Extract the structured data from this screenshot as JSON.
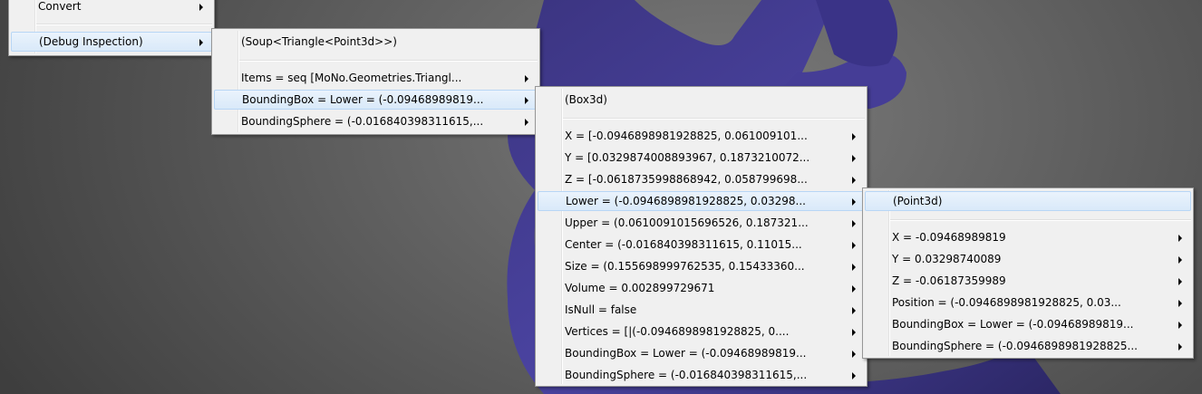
{
  "menu1": {
    "items": [
      {
        "label": "Convert",
        "has_submenu": true
      },
      {
        "label": "(Debug Inspection)",
        "has_submenu": true,
        "highlighted": true
      }
    ]
  },
  "menu2": {
    "header": "(Soup<Triangle<Point3d>>)",
    "items": [
      {
        "label": "Items = seq  [MoNo.Geometries.Triangl...",
        "has_submenu": true
      },
      {
        "label": "BoundingBox = Lower = (-0.09468989819...",
        "has_submenu": true,
        "highlighted": true
      },
      {
        "label": "BoundingSphere = (-0.016840398311615,...",
        "has_submenu": true
      }
    ]
  },
  "menu3": {
    "header": "(Box3d)",
    "items": [
      {
        "label": "X = [-0.0946898981928825, 0.061009101...",
        "has_submenu": true
      },
      {
        "label": "Y = [0.0329874008893967, 0.1873210072...",
        "has_submenu": true
      },
      {
        "label": "Z = [-0.0618735998868942, 0.058799698...",
        "has_submenu": true
      },
      {
        "label": "Lower = (-0.0946898981928825, 0.03298...",
        "has_submenu": true,
        "highlighted": true
      },
      {
        "label": "Upper = (0.0610091015696526, 0.187321...",
        "has_submenu": true
      },
      {
        "label": "Center = (-0.016840398311615, 0.11015...",
        "has_submenu": true
      },
      {
        "label": "Size = (0.155698999762535, 0.15433360...",
        "has_submenu": true
      },
      {
        "label": "Volume = 0.002899729671",
        "has_submenu": true
      },
      {
        "label": "IsNull = false",
        "has_submenu": true
      },
      {
        "label": "Vertices = [|(-0.0946898981928825, 0....",
        "has_submenu": true
      },
      {
        "label": "BoundingBox = Lower = (-0.09468989819...",
        "has_submenu": true
      },
      {
        "label": "BoundingSphere = (-0.016840398311615,...",
        "has_submenu": true
      }
    ]
  },
  "menu4": {
    "header": "(Point3d)",
    "items": [
      {
        "label": "X = -0.09468989819",
        "has_submenu": true
      },
      {
        "label": "Y = 0.03298740089",
        "has_submenu": true
      },
      {
        "label": "Z = -0.06187359989",
        "has_submenu": true
      },
      {
        "label": "Position = (-0.0946898981928825, 0.03...",
        "has_submenu": true
      },
      {
        "label": "BoundingBox = Lower = (-0.09468989819...",
        "has_submenu": true
      },
      {
        "label": "BoundingSphere = (-0.0946898981928825...",
        "has_submenu": true
      }
    ]
  },
  "colors": {
    "menu_bg": "#f0f0f0",
    "highlight": "#d9e9f9",
    "mesh": "#3d3783",
    "background": "#5f5f5f"
  }
}
